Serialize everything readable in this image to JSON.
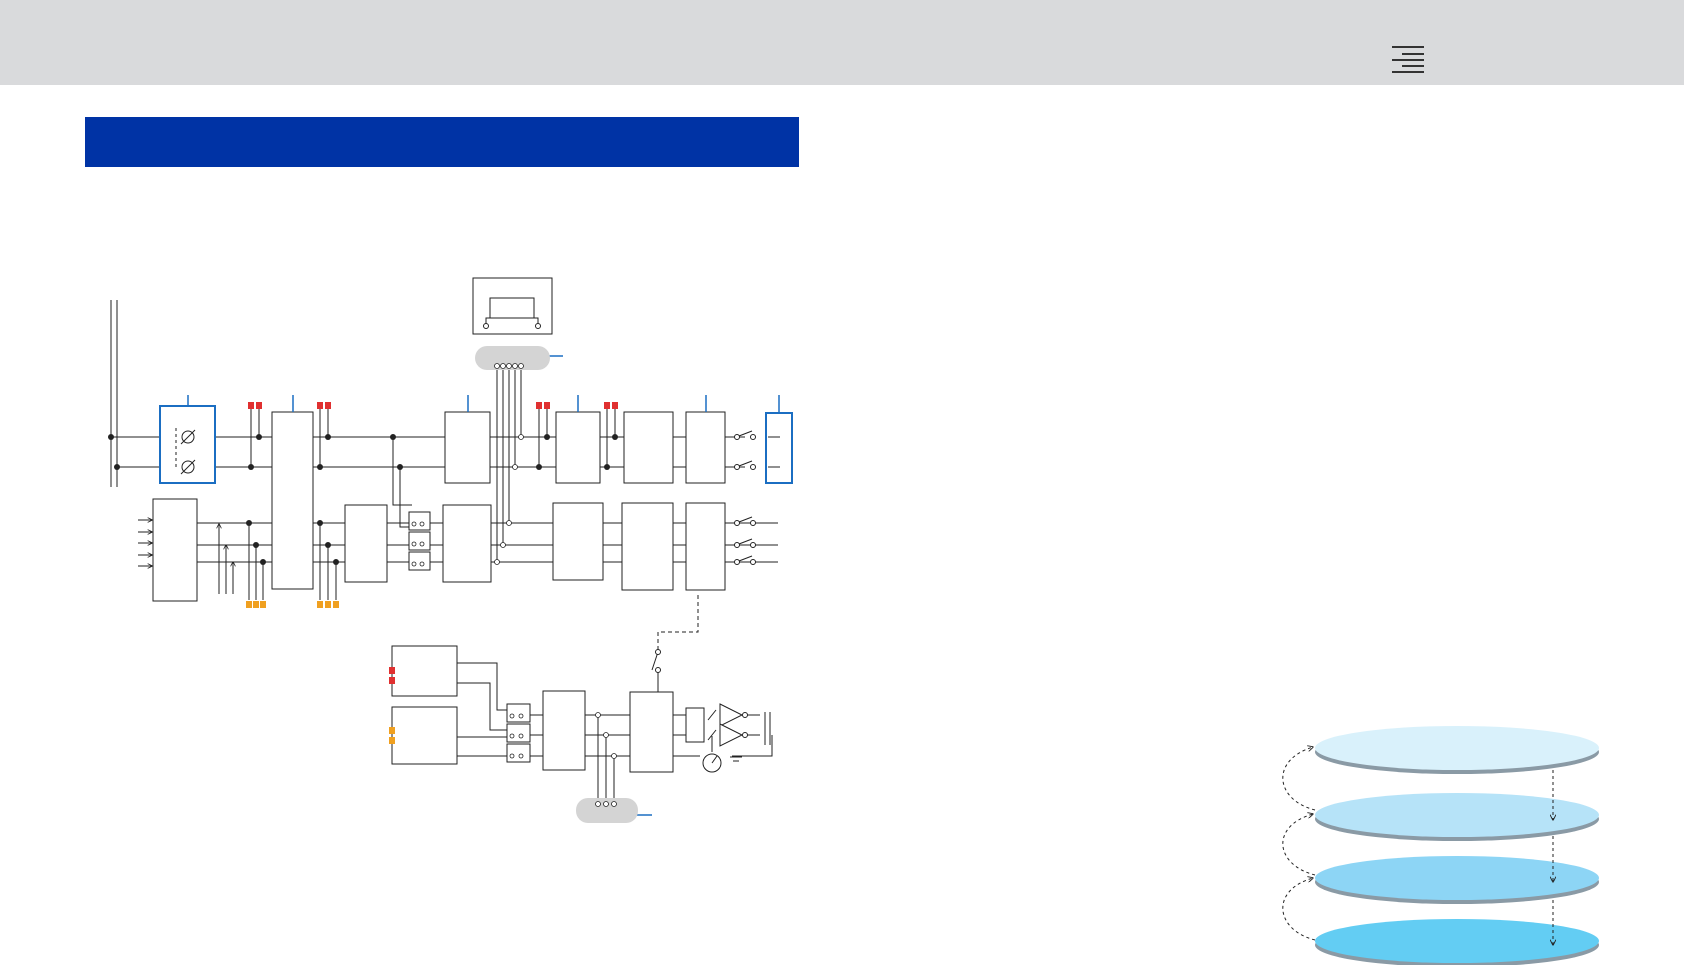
{
  "header": {
    "menu_icon": "hamburger-menu-icon"
  },
  "section": {
    "title": "",
    "bar_color": "#0033a5"
  },
  "diagram": {
    "accent_color": "#1b6ec2",
    "red_marker_color": "#e03030",
    "orange_marker_color": "#f0a020",
    "connector_color": "#d4d4d4",
    "layer_colors": [
      "#d9f1fb",
      "#b6e3f8",
      "#8dd5f5",
      "#63cdf3"
    ]
  }
}
